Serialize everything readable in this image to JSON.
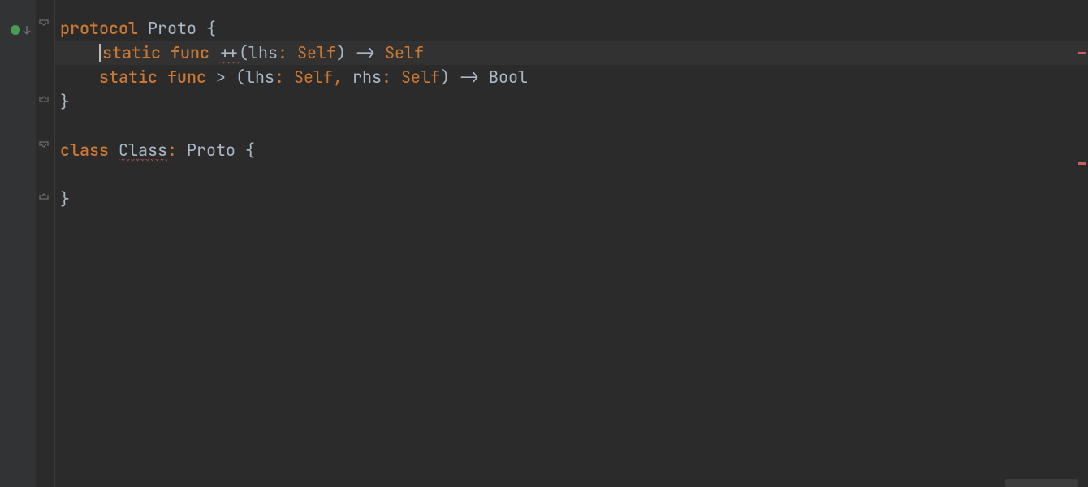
{
  "gutter": {
    "run_marker_title": "run"
  },
  "code": {
    "line1": {
      "kw_protocol": "protocol",
      "name": "Proto",
      "open_brace": " {"
    },
    "line2": {
      "indent": "    ",
      "kw_static": "static",
      "kw_func": "func",
      "op": "++",
      "paren_open": "(",
      "param1_label": "lhs",
      "colon": ":",
      "param1_type": "Self",
      "paren_close": ")",
      "arrow": "->",
      "return_type": "Self"
    },
    "line3": {
      "indent": "    ",
      "kw_static": "static",
      "kw_func": "func",
      "op": ">",
      "paren_open": "(",
      "param1_label": "lhs",
      "colon1": ":",
      "param1_type": "Self",
      "comma": ",",
      "param2_label": "rhs",
      "colon2": ":",
      "param2_type": "Self",
      "paren_close": ")",
      "arrow": "->",
      "return_type": "Bool"
    },
    "line4": {
      "close_brace": "}"
    },
    "line6": {
      "kw_class": "class",
      "name": "Class",
      "colon": ":",
      "proto": "Proto",
      "open_brace": " {"
    },
    "line8": {
      "close_brace": "}"
    }
  },
  "fold": {
    "open_top": "⌄",
    "close": "⌃"
  }
}
